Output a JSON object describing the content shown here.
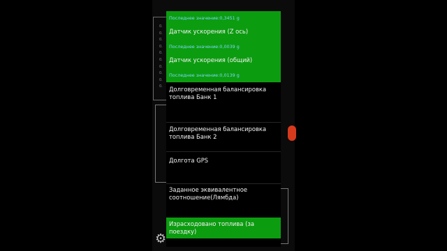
{
  "colors": {
    "selected_bg": "#0c9c10",
    "hint_text": "#7fd7ff",
    "menu_bg": "#000000",
    "text": "#f2f2f2"
  },
  "background": {
    "axis_ticks": [
      "0.",
      "0.",
      "0.",
      "0.",
      "0.",
      "0.",
      "0.",
      "0.",
      "0.",
      "0."
    ]
  },
  "menu": {
    "items": [
      {
        "hint": "Последнее значение:0,3451 g",
        "label": "Датчик ускорения (Z ось)",
        "selected": true
      },
      {
        "hint": "Последнее значение:0,0039 g",
        "label": "Датчик ускорения (общий)",
        "selected": true
      },
      {
        "hint": "Последнее значение:0,0139 g",
        "label": "",
        "selected": true
      },
      {
        "hint": "",
        "label": "Долговременная балансировка топлива  Банк 1",
        "selected": false
      },
      {
        "hint": "",
        "label": "Долговременная балансировка топлива  Банк 2",
        "selected": false
      },
      {
        "hint": "",
        "label": "Долгота GPS",
        "selected": false
      },
      {
        "hint": "",
        "label": "Заданное эквивалентное соотношение(Лямбда)",
        "selected": false
      },
      {
        "hint": "",
        "label": "Израсходовано топлива (за поездку)",
        "selected": true
      }
    ]
  },
  "icons": {
    "settings": "gear-icon"
  }
}
